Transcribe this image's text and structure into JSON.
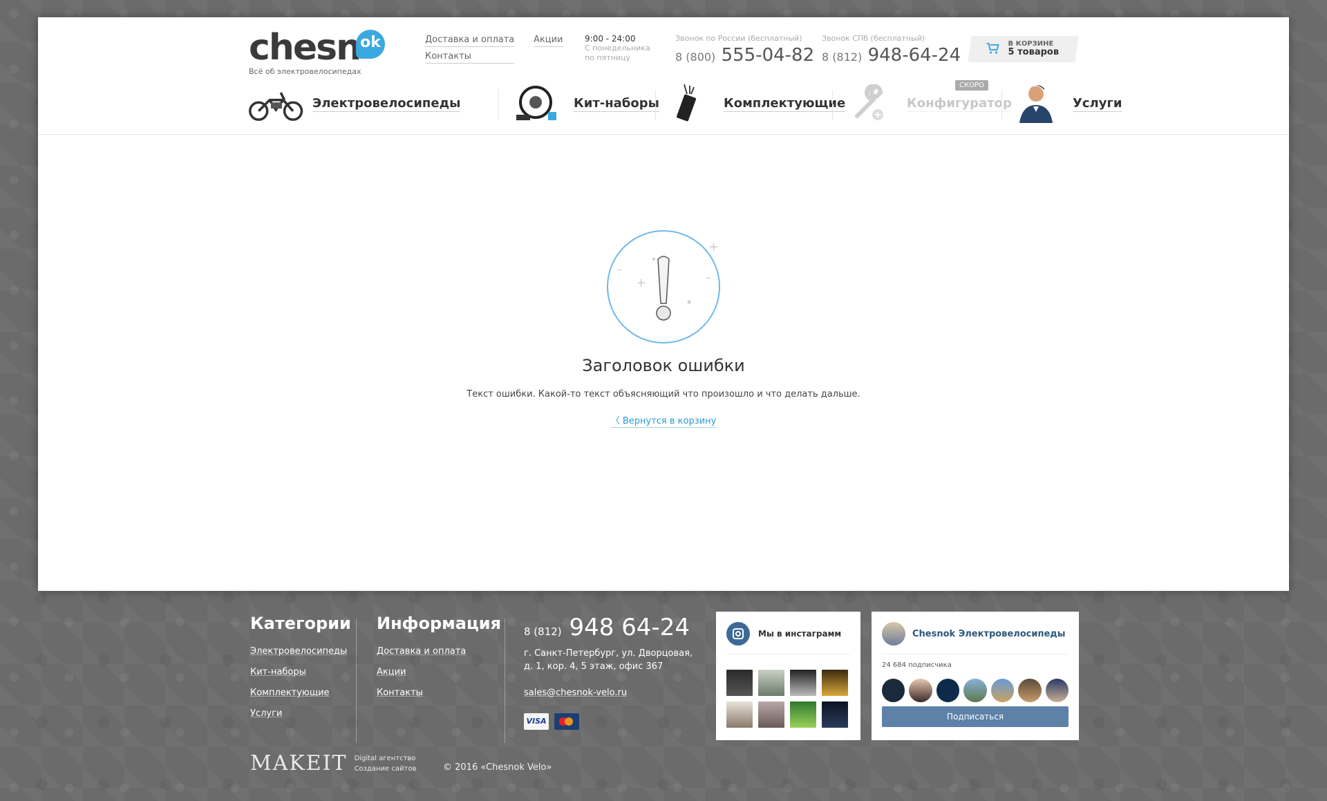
{
  "header": {
    "logo": {
      "word": "chesn",
      "badge": "ok",
      "tagline": "Всё об электровелосипедах"
    },
    "links_col1": [
      "Доставка и оплата",
      "Контакты"
    ],
    "links_col2": [
      "Акции"
    ],
    "hours": {
      "time": "9:00 - 24:00",
      "days_line1": "С понедельника",
      "days_line2": "по пятницу"
    },
    "phone_russia": {
      "label": "Звонок по России (бесплатный)",
      "code": "8 (800)",
      "number": "555-04-82"
    },
    "phone_spb": {
      "label": "Звонок СПб (бесплатный)",
      "code": "8 (812)",
      "number": "948-64-24"
    },
    "cart": {
      "label": "в корзине",
      "count": "5 товаров",
      "icon": "cart-icon"
    }
  },
  "nav": [
    {
      "label": "Электровелосипеды",
      "icon": "ebike-icon"
    },
    {
      "label": "Кит-наборы",
      "icon": "motor-wheel-icon"
    },
    {
      "label": "Комплектующие",
      "icon": "controller-icon"
    },
    {
      "label": "Конфигуратор",
      "icon": "wrench-icon",
      "badge": "скоро",
      "disabled": true
    },
    {
      "label": "Услуги",
      "icon": "man-avatar-icon"
    }
  ],
  "error": {
    "title": "Заголовок ошибки",
    "text": "Текст ошибки. Какой-то текст объясняющий что произошло и что делать дальше.",
    "link_prefix": "〈",
    "link": "Вернутся в корзину",
    "icon": "exclamation-icon"
  },
  "footer": {
    "categories": {
      "title": "Категории",
      "items": [
        "Электровелосипеды",
        "Кит-наборы",
        "Комплектующие",
        "Услуги"
      ]
    },
    "info": {
      "title": "Информация",
      "items": [
        "Доставка и оплата",
        "Акции",
        "Контакты"
      ]
    },
    "contacts": {
      "phone_code": "8 (812)",
      "phone": "948 64-24",
      "address_line1": "г. Санкт-Петербург, ул. Дворцовая,",
      "address_line2": "д. 1, кор. 4, 5 этаж, офис 367",
      "email": "sales@chesnok-velo.ru",
      "visa": "VISA"
    },
    "instagram": {
      "title": "Мы в инстаграмм",
      "icon": "instagram-icon"
    },
    "vk": {
      "title": "Chesnok Электровелосипеды",
      "subscribers": "24 684 подписчика",
      "button": "Подписаться"
    },
    "makeit": {
      "word": "MAKEIT",
      "line1": "Digital агентство",
      "line2": "Создание сайтов"
    },
    "copyright": "© 2016 «Chesnok Velo»"
  },
  "colors": {
    "accent": "#3aa9e0",
    "vk_button": "#5e81a8",
    "background": "#6b6b6b"
  }
}
